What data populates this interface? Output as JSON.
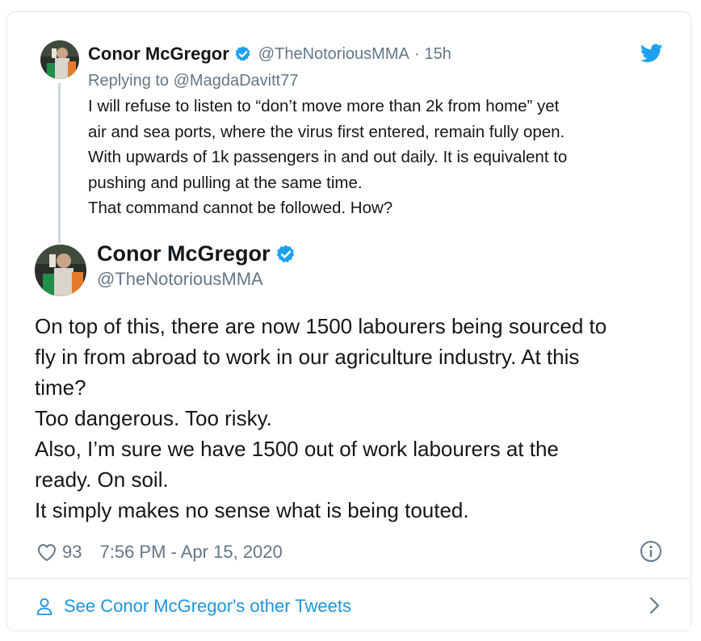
{
  "parent_tweet": {
    "author_name": "Conor McGregor",
    "author_handle": "@TheNotoriousMMA",
    "separator": "·",
    "time": "15h",
    "replying_prefix": "Replying to",
    "replying_to": "@MagdaDavitt77",
    "text_lines": [
      "I will refuse to listen to “don’t move more than 2k from home” yet",
      "air and sea ports, where the virus first entered, remain fully open.",
      "With upwards of 1k passengers in and out daily. It is equivalent to",
      "pushing and pulling at the same time.",
      "That command cannot be followed. How?"
    ]
  },
  "main_tweet": {
    "author_name": "Conor McGregor",
    "author_handle": "@TheNotoriousMMA",
    "text_lines": [
      "On top of this, there are now 1500 labourers being sourced to",
      "fly in from abroad to work in our agriculture industry. At this",
      "time?",
      "Too dangerous. Too risky.",
      "Also, I’m sure we have 1500 out of work labourers at the",
      "ready. On soil.",
      "It simply makes no sense what is being touted."
    ],
    "like_count": "93",
    "timestamp": "7:56 PM - Apr 15, 2020"
  },
  "footer": {
    "see_more_label": "See Conor McGregor's other Tweets"
  },
  "icons": {
    "verified": "verified-badge-icon",
    "bird": "twitter-bird-icon",
    "heart": "heart-icon",
    "info": "info-icon",
    "person": "person-icon",
    "chevron": "chevron-right-icon"
  },
  "colors": {
    "twitter_blue": "#1da1f2",
    "link_blue": "#1b95e0",
    "text_primary": "#14171a",
    "text_secondary": "#657786",
    "border": "#e1e8ed"
  }
}
